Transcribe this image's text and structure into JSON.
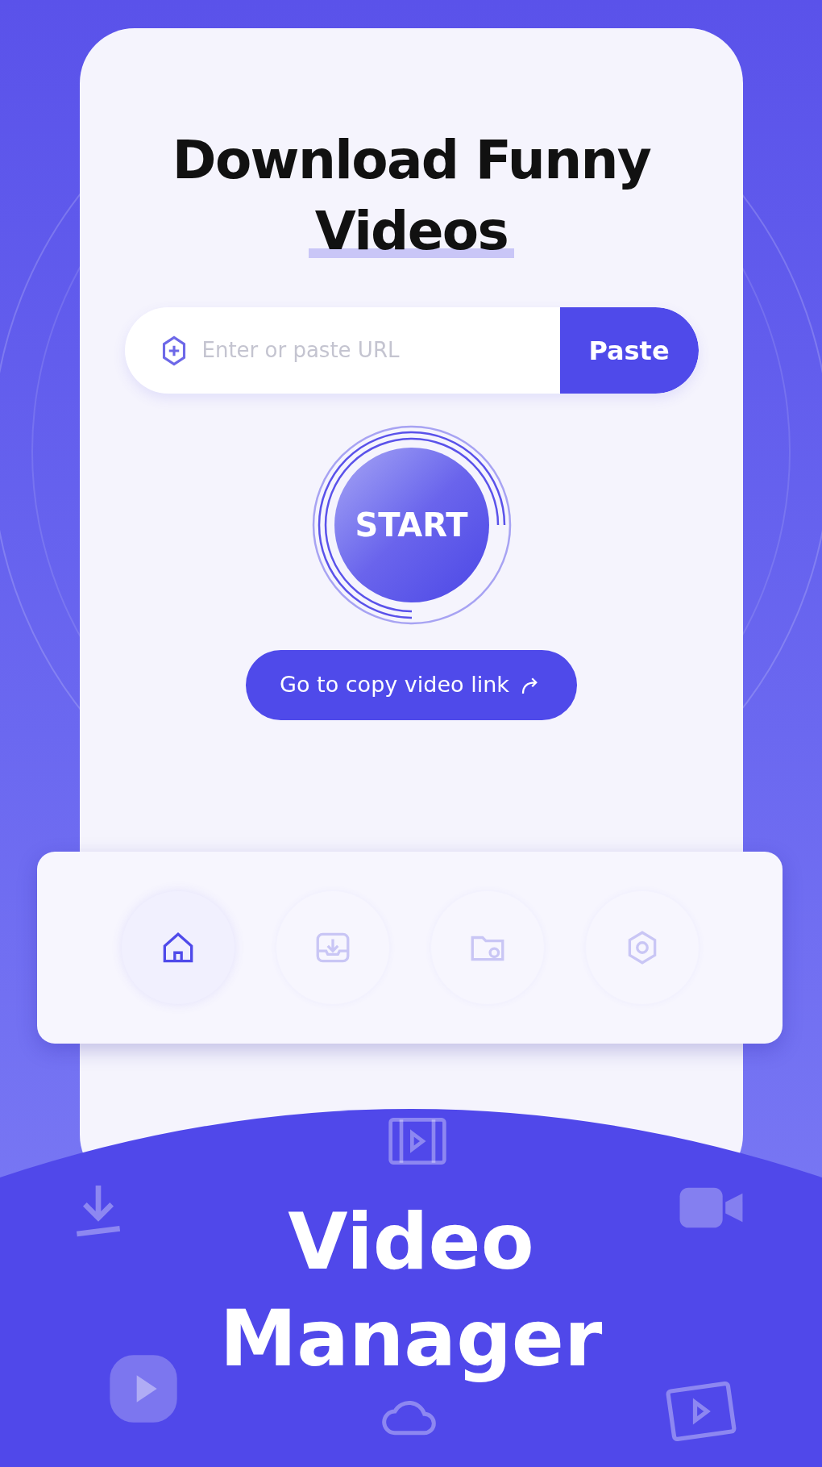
{
  "screen": {
    "title_lines": [
      {
        "text": "Download Funny",
        "highlighted": false
      },
      {
        "text": "Videos",
        "highlighted": true
      }
    ]
  },
  "url_field": {
    "placeholder": "Enter or paste URL",
    "button": "Paste"
  },
  "start_button": {
    "label": "START"
  },
  "copy_link_button": {
    "label": "Go to copy video link"
  },
  "bottom_nav": [
    {
      "kind": "home",
      "selected": true
    },
    {
      "kind": "download",
      "selected": false
    },
    {
      "kind": "folder",
      "selected": false
    },
    {
      "kind": "settings",
      "selected": false
    }
  ],
  "banner": {
    "title_lines": [
      "Video",
      "Manager"
    ]
  }
}
